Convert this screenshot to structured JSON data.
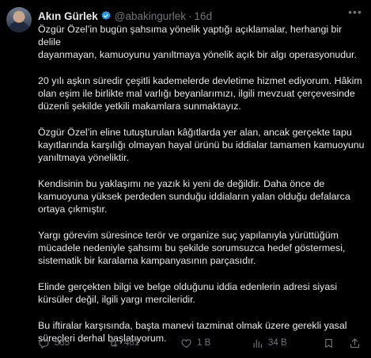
{
  "author": {
    "name": "Akın Gürlek",
    "handle": "@abakingurlek",
    "time": "16d"
  },
  "paragraphs": [
    "Özgür Özel’in bugün şahsıma yönelik yaptığı açıklamalar, herhangi bir delile\ndayanmayan, kamuoyunu yanıltmaya yönelik açık bir algı operasyonudur.",
    "20 yılı aşkın süredir çeşitli kademelerde devletime hizmet ediyorum. Hâkim\nolan eşim ile birlikte mal varlığı beyanlarımızı, ilgili mevzuat çerçevesinde\ndüzenli şekilde yetkili makamlara sunmaktayız.",
    "Özgür Özel’in eline tutuşturulan kâğıtlarda yer alan, ancak gerçekte tapu\nkayıtlarında karşılığı olmayan hayal ürünü bu iddialar tamamen kamuoyunu\nyanıltmaya yöneliktir.",
    "Kendisinin bu yaklaşımı ne yazık ki yeni de değildir. Daha önce de\nkamuoyuna yüksek perdeden sunduğu iddiaların yalan olduğu defalarca\nortaya çıkmıştır.",
    "Yargı görevim süresince terör ve organize suç yapılanıyla yürüttüğüm\nmücadele nedeniyle şahsımı bu şekilde sorumsuzca hedef göstermesi,\nsistematik bir karalama kampanyasının parçasıdır.",
    "Elinde gerçekten bilgi ve belge olduğunu iddia edenlerin adresi siyasi\nkürsüler değil, ilgili yargı mercileridir.",
    "Bu iftiralar karşısında, başta manevi tazminat olmak üzere gerekli yasal\nsüreçleri derhal başlatıyorum."
  ],
  "actions": {
    "replies": "535",
    "reposts": "481",
    "likes": "1 B",
    "views": "34 B"
  },
  "icons": [
    "verified-badge-icon",
    "more-icon",
    "reply-icon",
    "repost-icon",
    "like-icon",
    "views-icon",
    "bookmark-icon",
    "share-icon"
  ],
  "colors": {
    "background": "#000000",
    "text": "#e7e9ea",
    "muted": "#71767b",
    "verified": "#1d9bf0"
  }
}
